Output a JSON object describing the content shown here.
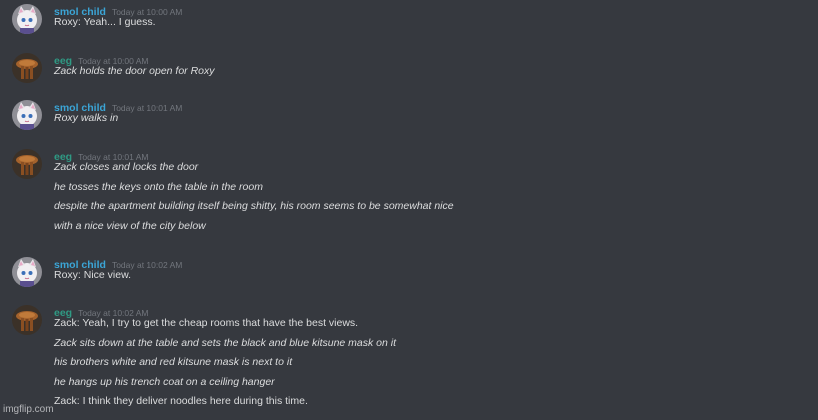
{
  "colors": {
    "background": "#36393f",
    "smol_child_name": "#3ba5d6",
    "eeg_name": "#2f9a84",
    "timestamp": "#72767d",
    "text": "#dcddde"
  },
  "messages": [
    {
      "author": "smol child",
      "avatar": "white-cat-girl-avatar",
      "timestamp": "Today at 10:00 AM",
      "lines": [
        {
          "text": "Roxy: Yeah... I guess.",
          "italic": false
        }
      ]
    },
    {
      "author": "eeg",
      "avatar": "wooden-stool-avatar",
      "timestamp": "Today at 10:00 AM",
      "lines": [
        {
          "text": "Zack holds the door open for Roxy",
          "italic": true
        }
      ]
    },
    {
      "author": "smol child",
      "avatar": "white-cat-girl-avatar",
      "timestamp": "Today at 10:01 AM",
      "lines": [
        {
          "text": "Roxy walks in",
          "italic": true
        }
      ]
    },
    {
      "author": "eeg",
      "avatar": "wooden-stool-avatar",
      "timestamp": "Today at 10:01 AM",
      "lines": [
        {
          "text": "Zack closes and locks the door",
          "italic": true
        },
        {
          "text": "he tosses the keys onto the table in the room",
          "italic": true
        },
        {
          "text": "despite the apartment building itself being shitty, his room seems to be somewhat nice",
          "italic": true
        },
        {
          "text": "with a nice view of the city below",
          "italic": true
        }
      ]
    },
    {
      "author": "smol child",
      "avatar": "white-cat-girl-avatar",
      "timestamp": "Today at 10:02 AM",
      "lines": [
        {
          "text": "Roxy: Nice view.",
          "italic": false
        }
      ]
    },
    {
      "author": "eeg",
      "avatar": "wooden-stool-avatar",
      "timestamp": "Today at 10:02 AM",
      "lines": [
        {
          "text": "Zack: Yeah, I try to get the cheap rooms that have the best views.",
          "italic": false
        },
        {
          "text": "Zack sits down at the table and sets the black and blue kitsune mask on it",
          "italic": true
        },
        {
          "text": "his brothers white and red kitsune mask is next to it",
          "italic": true
        },
        {
          "text": "he hangs up his trench coat on a ceiling hanger",
          "italic": true
        },
        {
          "text": "Zack: I think they deliver noodles here during this time.",
          "italic": false
        }
      ]
    }
  ],
  "watermark": "imgflip.com"
}
